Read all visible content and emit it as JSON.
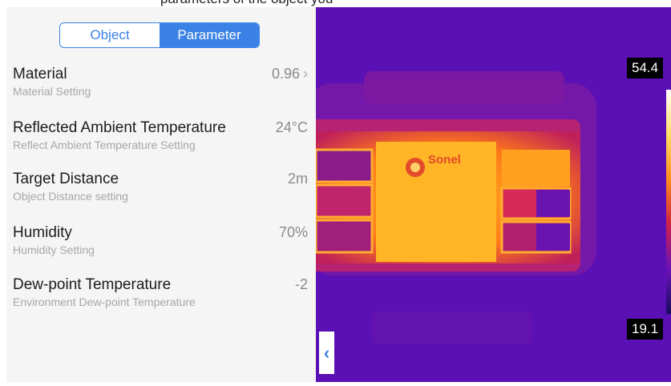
{
  "header": {
    "partial_text": "parameters of the object you"
  },
  "tabs": [
    {
      "label": "Object",
      "active": false
    },
    {
      "label": "Parameter",
      "active": true
    }
  ],
  "settings": [
    {
      "title": "Material",
      "subtitle": "Material Setting",
      "value": "0.96",
      "has_chevron": true
    },
    {
      "title": "Reflected Ambient Temperature",
      "subtitle": "Reflect Ambient Temperature Setting",
      "value": "24°C"
    },
    {
      "title": "Target Distance",
      "subtitle": "Object Distance setting",
      "value": "2m"
    },
    {
      "title": "Humidity",
      "subtitle": "Humidity Setting",
      "value": "70%"
    },
    {
      "title": "Dew-point Temperature",
      "subtitle": "Environment Dew-point Temperature",
      "value": "-2"
    }
  ],
  "thermal": {
    "logo_text": "Sonel",
    "max_temp": "54.4",
    "min_temp": "19.1"
  },
  "icons": {
    "chevron_right": "›",
    "chevron_left": "‹"
  },
  "colors": {
    "accent": "#3b82e6",
    "panel_bg": "#f5f5f5",
    "thermal_bg": "#5a10b4"
  }
}
